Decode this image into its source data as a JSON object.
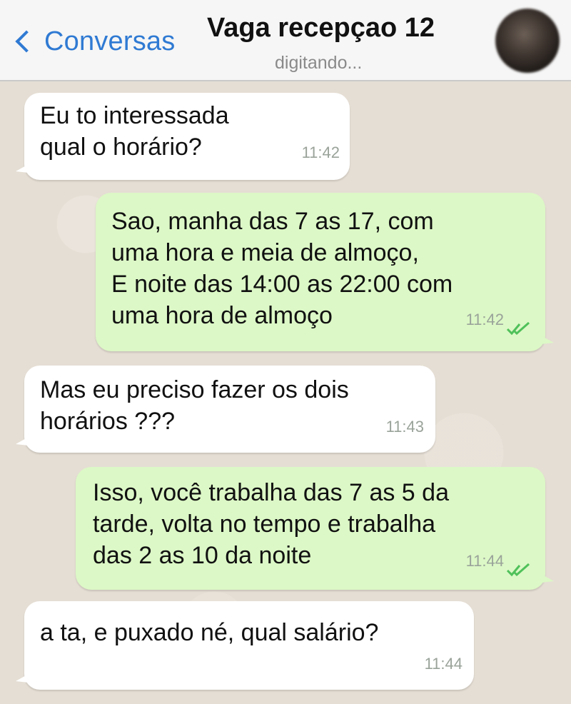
{
  "header": {
    "back_label": "Conversas",
    "title": "Vaga recepçao 12",
    "status": "digitando..."
  },
  "messages": [
    {
      "direction": "in",
      "text": "Eu to interessada\nqual o horário?",
      "time": "11:42"
    },
    {
      "direction": "out",
      "text": "Sao, manha das 7 as 17, com\numa hora e meia de almoço,\nE noite das 14:00 as 22:00 com\numa hora de almoço",
      "time": "11:42",
      "read": true
    },
    {
      "direction": "in",
      "text": "Mas eu preciso fazer os dois\nhorários ???",
      "time": "11:43"
    },
    {
      "direction": "out",
      "text": "Isso, você trabalha das 7 as 5 da\ntarde, volta no tempo e trabalha\ndas 2 as 10 da noite",
      "time": "11:44",
      "read": true
    },
    {
      "direction": "in",
      "text": "a ta, e puxado né, qual salário?",
      "time": "11:44"
    }
  ],
  "colors": {
    "accent": "#2f7ad3",
    "outgoing_bubble": "#dcf8c6",
    "incoming_bubble": "#ffffff",
    "read_tick": "#4fc15a",
    "chat_background": "#e5ded4"
  }
}
